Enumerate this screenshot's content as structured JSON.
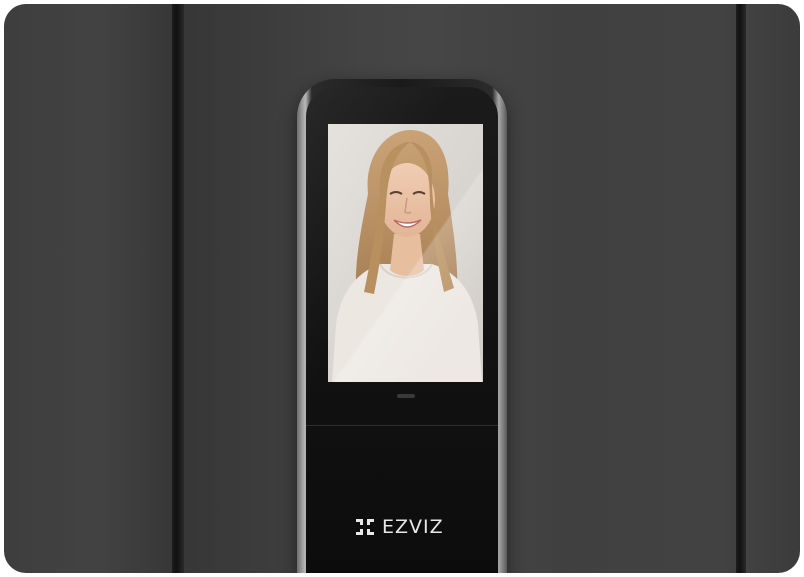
{
  "brand": {
    "name": "EZVIZ"
  },
  "icons": {
    "brand_logo": "ezviz-logo-icon"
  },
  "colors": {
    "wall": "#3e3e3e",
    "device_body": "#141414",
    "brand_text": "#e8e8e8"
  }
}
